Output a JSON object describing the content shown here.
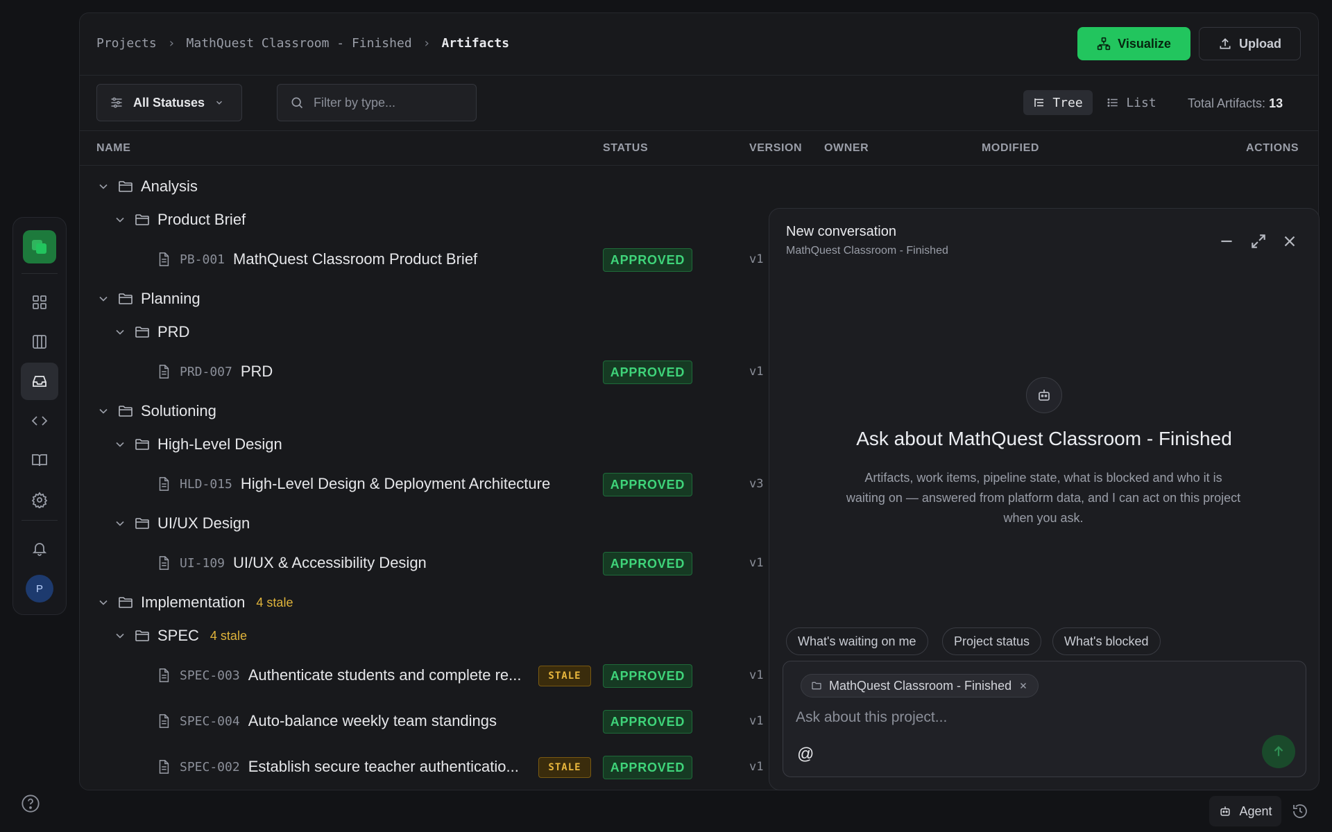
{
  "breadcrumb": [
    "Projects",
    "MathQuest Classroom - Finished",
    "Artifacts"
  ],
  "header": {
    "visualize_label": "Visualize",
    "upload_label": "Upload"
  },
  "filters": {
    "status_label": "All Statuses",
    "type_placeholder": "Filter by type..."
  },
  "view": {
    "tree_label": "Tree",
    "list_label": "List",
    "total_label": "Total Artifacts:",
    "total_value": "13",
    "active": "Tree"
  },
  "columns": [
    "NAME",
    "STATUS",
    "VERSION",
    "OWNER",
    "MODIFIED",
    "ACTIONS"
  ],
  "tree": {
    "analysis": {
      "label": "Analysis"
    },
    "product_brief": {
      "label": "Product Brief"
    },
    "pb001": {
      "code": "PB-001",
      "name": "MathQuest Classroom Product Brief",
      "status": "APPROVED",
      "version": "v1"
    },
    "planning": {
      "label": "Planning"
    },
    "prd": {
      "label": "PRD"
    },
    "prd007": {
      "code": "PRD-007",
      "name": "PRD",
      "status": "APPROVED",
      "version": "v1"
    },
    "solutioning": {
      "label": "Solutioning"
    },
    "hld": {
      "label": "High-Level Design"
    },
    "hld015": {
      "code": "HLD-015",
      "name": "High-Level Design & Deployment Architecture",
      "status": "APPROVED",
      "version": "v3"
    },
    "uiux": {
      "label": "UI/UX Design"
    },
    "ui109": {
      "code": "UI-109",
      "name": "UI/UX & Accessibility Design",
      "status": "APPROVED",
      "version": "v1"
    },
    "implementation": {
      "label": "Implementation",
      "note": "4 stale"
    },
    "spec": {
      "label": "SPEC",
      "note": "4 stale"
    },
    "spec003": {
      "code": "SPEC-003",
      "name": "Authenticate students and complete re...",
      "stale": "STALE",
      "status": "APPROVED",
      "version": "v1"
    },
    "spec004": {
      "code": "SPEC-004",
      "name": "Auto-balance weekly team standings",
      "status": "APPROVED",
      "version": "v1"
    },
    "spec002": {
      "code": "SPEC-002",
      "name": "Establish secure teacher authenticatio...",
      "stale": "STALE",
      "status": "APPROVED",
      "version": "v1"
    }
  },
  "chat": {
    "title": "New conversation",
    "subtitle": "MathQuest Classroom - Finished",
    "ask_title": "Ask about MathQuest Classroom - Finished",
    "ask_desc": "Artifacts, work items, pipeline state, what is blocked and who it is waiting on — answered from platform data, and I can act on this project when you ask.",
    "suggestions": [
      "What's waiting on me",
      "Project status",
      "What's blocked"
    ],
    "context_chip": "MathQuest Classroom - Finished",
    "input_placeholder": "Ask about this project...",
    "mention_symbol": "@"
  },
  "footer": {
    "agent_label": "Agent"
  },
  "user": {
    "avatar_initial": "P"
  },
  "colors": {
    "accent": "#22c55e",
    "approved": "#3fd47a",
    "stale": "#e0b43b",
    "background": "#121316"
  },
  "icons": [
    "logo-icon",
    "grid-icon",
    "board-icon",
    "inbox-icon",
    "code-icon",
    "book-icon",
    "gear-icon",
    "bell-icon",
    "help-icon",
    "folder-icon",
    "document-icon",
    "chevron-down-icon",
    "search-icon",
    "sliders-icon",
    "tree-icon",
    "list-icon",
    "upload-icon",
    "visualize-icon",
    "bot-icon",
    "minimize-icon",
    "expand-icon",
    "close-icon",
    "send-icon",
    "history-icon"
  ]
}
